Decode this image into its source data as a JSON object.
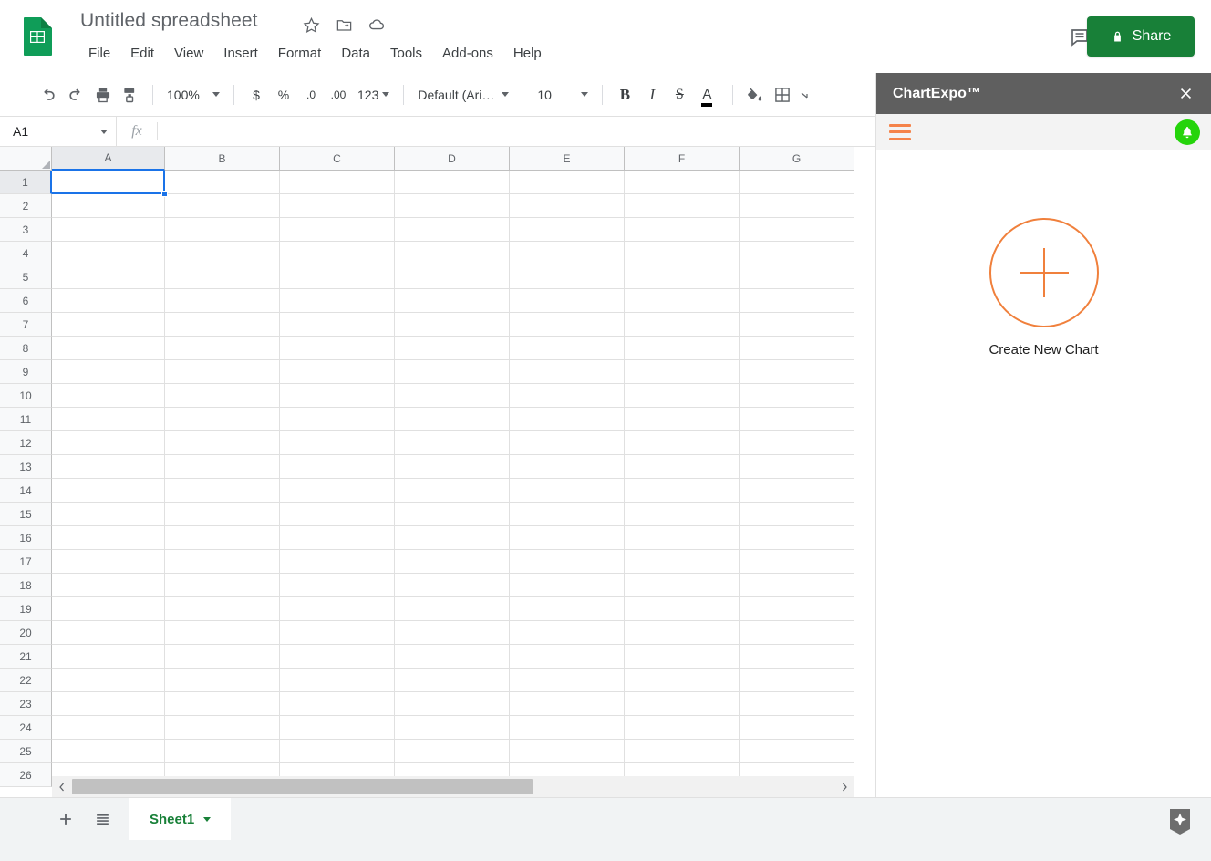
{
  "header": {
    "logo_icon": "google-sheets-logo",
    "doc_title": "Untitled spreadsheet",
    "title_icons": [
      {
        "name": "star-icon",
        "glyph": "☆"
      },
      {
        "name": "move-to-folder-icon",
        "glyph": "folder"
      },
      {
        "name": "cloud-saved-icon",
        "glyph": "cloud"
      }
    ],
    "menus": [
      "File",
      "Edit",
      "View",
      "Insert",
      "Format",
      "Data",
      "Tools",
      "Add-ons",
      "Help"
    ],
    "comment_icon": "comment-icon",
    "share": {
      "label": "Share",
      "icon": "lock-icon",
      "color": "#188038"
    }
  },
  "toolbar": {
    "undo": "undo-icon",
    "redo": "redo-icon",
    "print": "print-icon",
    "paint_format": "paint-format-icon",
    "zoom_value": "100%",
    "currency": "$",
    "percent": "%",
    "decrease_decimal": ".0",
    "increase_decimal": ".00",
    "number_format": "123",
    "font_value": "Default (Ari…",
    "font_size_value": "10",
    "bold": "B",
    "italic": "I",
    "strikethrough": "S",
    "text_color": "A",
    "fill_color": "fill-color-icon",
    "borders": "borders-icon",
    "more": "more-options-icon"
  },
  "formula_bar": {
    "name_box_value": "A1",
    "fx_label": "fx",
    "formula_value": "",
    "formula_placeholder": ""
  },
  "grid": {
    "columns": [
      "A",
      "B",
      "C",
      "D",
      "E",
      "F",
      "G"
    ],
    "rows": [
      "1",
      "2",
      "3",
      "4",
      "5",
      "6",
      "7",
      "8",
      "9",
      "10",
      "11",
      "12",
      "13",
      "14",
      "15",
      "16",
      "17",
      "18",
      "19",
      "20",
      "21",
      "22",
      "23",
      "24",
      "25",
      "26"
    ],
    "selected_cell": "A1",
    "selected_column": "A",
    "selected_row": "1",
    "cell_values": {},
    "selection_color": "#1a73e8"
  },
  "bottom": {
    "add_sheet_icon": "add-sheet-icon",
    "all_sheets_icon": "all-sheets-icon",
    "sheet_tab_name": "Sheet1",
    "sheet_tab_caret": "chevron-down-icon",
    "explore_icon": "explore-icon"
  },
  "panel": {
    "title": "ChartExpo™",
    "close_icon": "close-icon",
    "menu_icon": "hamburger-menu-icon",
    "notification_icon": "bell-icon",
    "header_color": "#5f5f5f",
    "accent_color": "#f0803c",
    "notification_color": "#25d40b",
    "create_chart": {
      "icon": "plus-icon",
      "label": "Create New Chart"
    }
  }
}
